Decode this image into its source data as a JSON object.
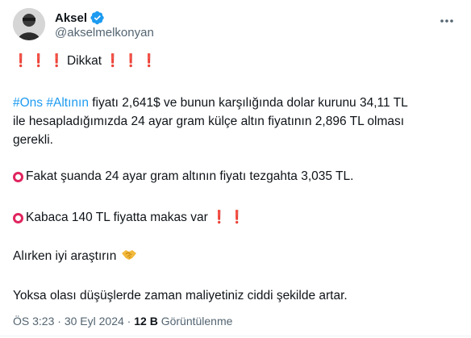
{
  "author": {
    "name": "Aksel",
    "handle": "@akselmelkonyan",
    "verified_color": "#1d9bf0",
    "avatar_icon": "person-avatar-icon"
  },
  "tweet": {
    "l1": {
      "text": "Dikkat",
      "excl": "❗"
    },
    "p2": {
      "tag1": "#Ons",
      "tag2": "#Altının",
      "line1_rest": " fiyatı 2,641$ ve bunun karşılığında dolar kurunu 34,11 TL",
      "line2": "ile hesapladığımızda 24 ayar gram külçe altın fiyatının 2,896 TL olması",
      "line3": "gerekli."
    },
    "p3": "Fakat şuanda 24 ayar gram altının fiyatı tezgahta 3,035 TL.",
    "p4": "Kabaca 140 TL fiyatta makas var",
    "p5": "Alırken iyi araştırın",
    "p6": "Yoksa olası düşüşlerde zaman maliyetiniz ciddi şekilde artar."
  },
  "meta": {
    "time": "ÖS 3:23",
    "sep1": " · ",
    "date": "30 Eyl 2024",
    "sep2": " · ",
    "views_count": "12 B",
    "views_label": " Görüntülenme"
  },
  "colors": {
    "link": "#1d9bf0",
    "secondary": "#536471",
    "alert": "#e0245e",
    "text": "#0f1419"
  }
}
